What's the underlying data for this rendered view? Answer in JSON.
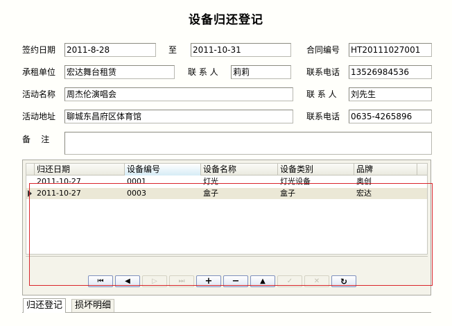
{
  "title": "设备归还登记",
  "form": {
    "sign_date": {
      "label": "签约日期",
      "value": "2011-8-28"
    },
    "to": {
      "label": "至",
      "value": "2011-10-31"
    },
    "contract_no": {
      "label": "合同编号",
      "value": "HT20111027001"
    },
    "renter": {
      "label": "承租单位",
      "value": "宏达舞台租赁"
    },
    "contact1": {
      "label": "联 系 人",
      "value": "莉莉"
    },
    "phone1": {
      "label": "联系电话",
      "value": "13526984536"
    },
    "activity": {
      "label": "活动名称",
      "value": "周杰伦演唱会"
    },
    "contact2": {
      "label": "联 系 人",
      "value": "刘先生"
    },
    "address": {
      "label": "活动地址",
      "value": "聊城东昌府区体育馆"
    },
    "phone2": {
      "label": "联系电话",
      "value": "0635-4265896"
    },
    "remark": {
      "label": "备    注",
      "value": ""
    }
  },
  "grid": {
    "columns": [
      "归还日期",
      "设备编号",
      "设备名称",
      "设备类别",
      "品牌"
    ],
    "rows": [
      [
        "2011-10-27",
        "0001",
        "灯光",
        "灯光设备",
        "奥创"
      ],
      [
        "2011-10-27",
        "0003",
        "盒子",
        "盒子",
        "宏达"
      ]
    ]
  },
  "navigator": {
    "first": "⏮",
    "prior": "◀",
    "next": "▷",
    "last": "⏭",
    "insert": "+",
    "delete": "−",
    "edit": "▲",
    "post": "✓",
    "cancel": "✕",
    "refresh": "↻"
  },
  "tabs": [
    "归还登记",
    "损坏明细"
  ]
}
